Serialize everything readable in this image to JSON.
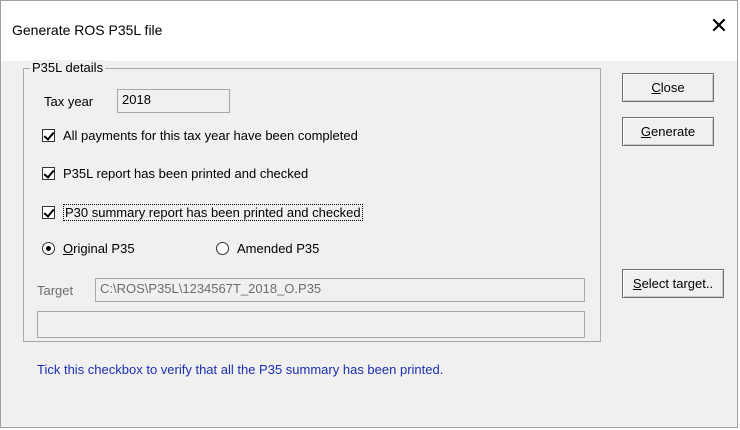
{
  "window": {
    "title": "Generate ROS P35L file",
    "close_glyph": "✕"
  },
  "group": {
    "legend": "P35L details"
  },
  "tax_year": {
    "label": "Tax year",
    "value": "2018"
  },
  "checkboxes": {
    "payments_completed": {
      "label": "All payments for this tax year have been completed",
      "checked": true
    },
    "p35l_printed": {
      "label": "P35L report has been printed and checked",
      "checked": true
    },
    "p30_printed": {
      "label": "P30 summary report has been printed and checked",
      "checked": true
    }
  },
  "radios": {
    "original": {
      "label_rest": "riginal P35",
      "accel": "O",
      "checked": true
    },
    "amended": {
      "label": "Amended P35",
      "checked": false
    }
  },
  "target": {
    "label": "Target",
    "value": "C:\\ROS\\P35L\\1234567T_2018_O.P35",
    "status_value": ""
  },
  "buttons": {
    "close": {
      "accel": "C",
      "rest": "lose"
    },
    "generate": {
      "accel": "G",
      "rest": "enerate"
    },
    "select_target": {
      "accel": "S",
      "rest": "elect target.."
    }
  },
  "hint_text": "Tick this checkbox to verify that all the P35 summary has been printed."
}
